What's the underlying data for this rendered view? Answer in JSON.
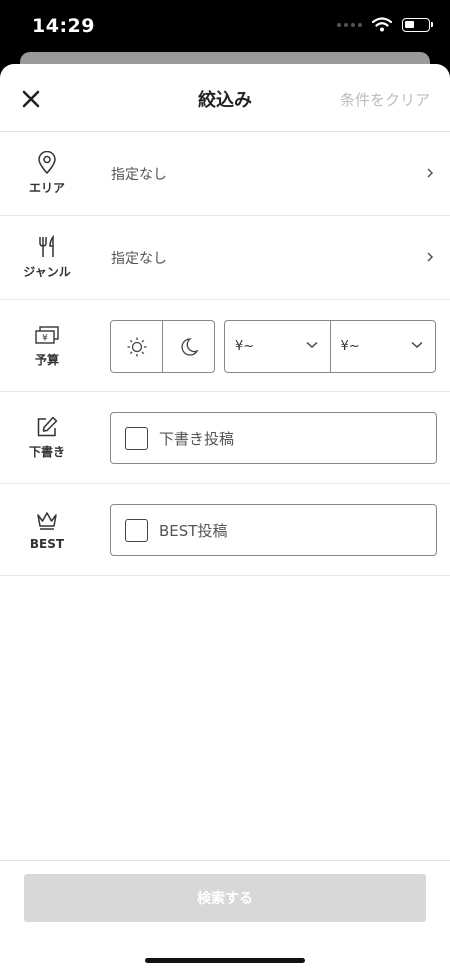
{
  "status_bar": {
    "time": "14:29",
    "battery_level": 0.45
  },
  "header": {
    "title": "絞込み",
    "clear_label": "条件をクリア"
  },
  "filters": {
    "area": {
      "label": "エリア",
      "value": "指定なし",
      "icon": "map-pin-icon"
    },
    "genre": {
      "label": "ジャンル",
      "value": "指定なし",
      "icon": "fork-knife-icon"
    },
    "budget": {
      "label": "予算",
      "icon": "money-icon",
      "time_options": [
        "sun-icon",
        "moon-icon"
      ],
      "min_price": "¥~",
      "max_price": "¥~"
    },
    "draft": {
      "label": "下書き",
      "checkbox_label": "下書き投稿",
      "checked": false,
      "icon": "pencil-icon"
    },
    "best": {
      "label": "BEST",
      "checkbox_label": "BEST投稿",
      "checked": false,
      "icon": "crown-icon"
    }
  },
  "footer": {
    "search_label": "検索する"
  }
}
